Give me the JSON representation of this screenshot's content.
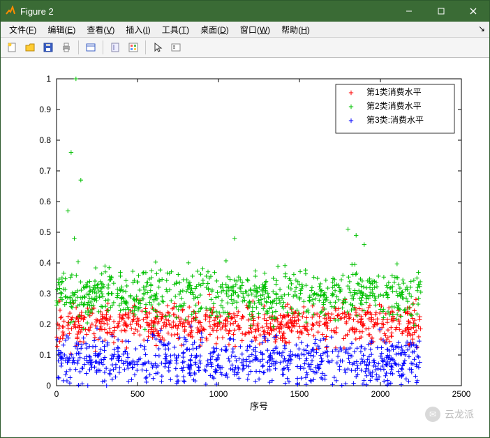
{
  "window": {
    "title": "Figure 2"
  },
  "menu": {
    "file": {
      "label": "文件",
      "key": "F"
    },
    "edit": {
      "label": "编辑",
      "key": "E"
    },
    "view": {
      "label": "查看",
      "key": "V"
    },
    "insert": {
      "label": "插入",
      "key": "I"
    },
    "tools": {
      "label": "工具",
      "key": "T"
    },
    "desktop": {
      "label": "桌面",
      "key": "D"
    },
    "windowm": {
      "label": "窗口",
      "key": "W"
    },
    "help": {
      "label": "帮助",
      "key": "H"
    }
  },
  "toolbar": {
    "new": "新建",
    "open": "打开",
    "save": "保存",
    "print": "打印",
    "link": "链接",
    "datacursor": "数据游标",
    "colorbar": "颜色栏",
    "pointer": "编辑",
    "insertlegend": "图例"
  },
  "watermark": {
    "text": "云龙派"
  },
  "chart_data": {
    "type": "scatter",
    "title": "",
    "xlabel": "序号",
    "ylabel": "",
    "xlim": [
      0,
      2500
    ],
    "ylim": [
      0,
      1
    ],
    "xticks": [
      0,
      500,
      1000,
      1500,
      2000,
      2500
    ],
    "yticks": [
      0,
      0.1,
      0.2,
      0.3,
      0.4,
      0.5,
      0.6,
      0.7,
      0.8,
      0.9,
      1
    ],
    "legend_position": "northeast",
    "series": [
      {
        "name": "第1类消费水平",
        "color": "#ff0000",
        "marker": "+",
        "n": 750,
        "xrange": [
          0,
          2250
        ],
        "band_center": 0.2,
        "band_spread": 0.045,
        "outliers": []
      },
      {
        "name": "第2类消费水平",
        "color": "#00c000",
        "marker": "+",
        "n": 750,
        "xrange": [
          0,
          2250
        ],
        "band_center": 0.3,
        "band_spread": 0.055,
        "outliers": [
          {
            "x": 120,
            "y": 1.0
          },
          {
            "x": 90,
            "y": 0.76
          },
          {
            "x": 150,
            "y": 0.67
          },
          {
            "x": 70,
            "y": 0.57
          },
          {
            "x": 110,
            "y": 0.48
          },
          {
            "x": 1100,
            "y": 0.48
          },
          {
            "x": 1800,
            "y": 0.51
          },
          {
            "x": 1850,
            "y": 0.49
          },
          {
            "x": 1900,
            "y": 0.46
          }
        ]
      },
      {
        "name": "第3类:消费水平",
        "color": "#0000ff",
        "marker": "+",
        "n": 750,
        "xrange": [
          0,
          2250
        ],
        "band_center": 0.08,
        "band_spread": 0.055,
        "outliers": []
      }
    ]
  }
}
